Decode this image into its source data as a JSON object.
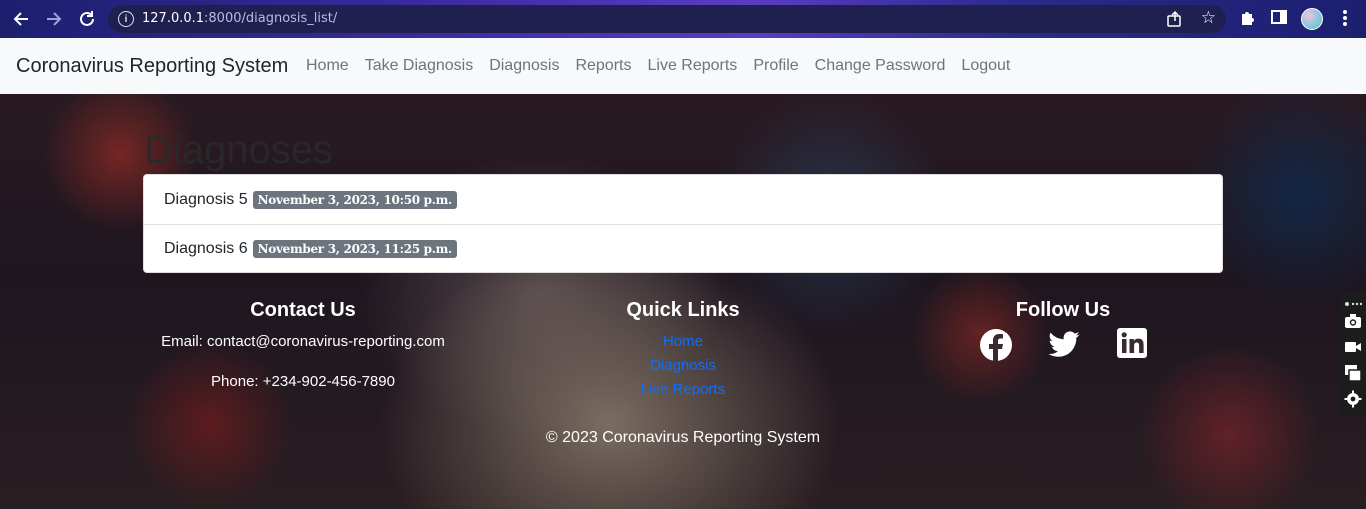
{
  "browser": {
    "url_host": "127.0.0.1",
    "url_path": ":8000/diagnosis_list/"
  },
  "navbar": {
    "brand": "Coronavirus Reporting System",
    "links": [
      "Home",
      "Take Diagnosis",
      "Diagnosis",
      "Reports",
      "Live Reports",
      "Profile",
      "Change Password",
      "Logout"
    ]
  },
  "main": {
    "heading": "Diagnoses",
    "items": [
      {
        "label": "Diagnosis 5",
        "date": "November 3, 2023, 10:50 p.m."
      },
      {
        "label": "Diagnosis 6",
        "date": "November 3, 2023, 11:25 p.m."
      }
    ]
  },
  "footer": {
    "contact_heading": "Contact Us",
    "email": "Email: contact@coronavirus-reporting.com",
    "phone": "Phone: +234-902-456-7890",
    "quick_heading": "Quick Links",
    "quick_links": [
      "Home",
      "Diagnosis",
      "Live Reports"
    ],
    "follow_heading": "Follow Us",
    "social_icons": [
      "facebook-icon",
      "twitter-icon",
      "linkedin-icon"
    ],
    "copyright": "© 2023 Coronavirus Reporting System"
  },
  "colors": {
    "link_blue": "#0d6efd",
    "badge_gray": "#6c757d",
    "navbar_bg": "#f8f9fa"
  }
}
